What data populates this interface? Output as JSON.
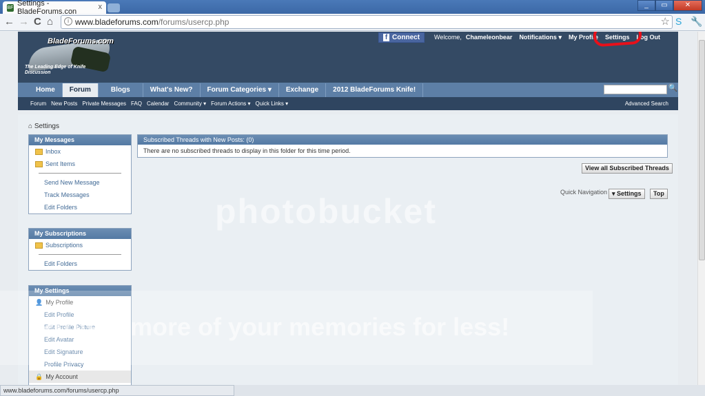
{
  "browser": {
    "tab_title": "Settings - BladeForums.con",
    "tab_close": "x",
    "url_host": "www.bladeforums.com",
    "url_path": "/forums/usercp.php",
    "back_glyph": "←",
    "forward_glyph": "→",
    "reload_glyph": "C",
    "home_glyph": "⌂",
    "star_glyph": "☆",
    "minimize_glyph": "_",
    "maximize_glyph": "▭",
    "close_glyph": "✕",
    "wrench_glyph": "🔧"
  },
  "header": {
    "logo_name": "BladeForums.com",
    "logo_tagline": "The Leading Edge of Knife Discussion",
    "fb_connect": "Connect",
    "fb_icon": "f",
    "welcome": "Welcome,",
    "username": "Chameleonbear",
    "notifications": "Notifications ▾",
    "my_profile": "My Profile",
    "settings": "Settings",
    "log_out": "Log Out"
  },
  "navbar": {
    "tabs": [
      "Home",
      "Forum",
      "Blogs",
      "What's New?",
      "Forum Categories ▾",
      "Exchange",
      "2012 BladeForums Knife!"
    ],
    "search_glyph": "🔍"
  },
  "subnav": {
    "links": [
      "Forum",
      "New Posts",
      "Private Messages",
      "FAQ",
      "Calendar",
      "Community ▾",
      "Forum Actions ▾",
      "Quick Links ▾"
    ],
    "advanced_search": "Advanced Search"
  },
  "content": {
    "breadcrumb": "Settings",
    "messages": {
      "title": "My Messages",
      "folders": [
        "Inbox",
        "Sent Items"
      ],
      "links": [
        "Send New Message",
        "Track Messages",
        "Edit Folders"
      ]
    },
    "subscriptions": {
      "title": "My Subscriptions",
      "folders": [
        "Subscriptions"
      ],
      "links": [
        "Edit Folders"
      ]
    },
    "settings_block": {
      "title": "My Settings",
      "profile_header": "My Profile",
      "profile_links": [
        "Edit Profile",
        "Edit Profile Picture",
        "Edit Avatar",
        "Edit Signature",
        "Profile Privacy"
      ],
      "account_header": "My Account"
    },
    "main": {
      "title": "Subscribed Threads with New Posts: (0)",
      "empty_text": "There are no subscribed threads to display in this folder for this time period.",
      "view_all": "View all Subscribed Threads",
      "quick_nav_label": "Quick Navigation",
      "settings_button": "▾ Settings",
      "top_button": "Top"
    }
  },
  "watermark": {
    "line1": "photobucket",
    "line2": "Protect more of your memories for less!"
  },
  "status_bar": "www.bladeforums.com/forums/usercp.php"
}
